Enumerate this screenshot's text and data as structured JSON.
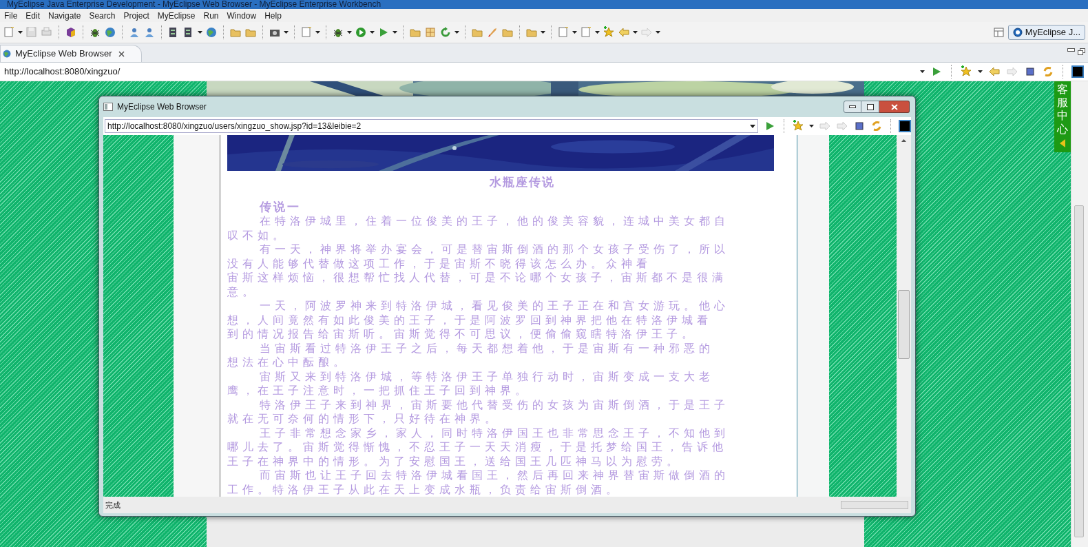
{
  "window": {
    "title": "MyEclipse Java Enterprise Development - MyEclipse Web Browser - MyEclipse Enterprise Workbench"
  },
  "menu": [
    "File",
    "Edit",
    "Navigate",
    "Search",
    "Project",
    "MyEclipse",
    "Run",
    "Window",
    "Help"
  ],
  "perspective": {
    "label": "MyEclipse J..."
  },
  "editor_tab": {
    "label": "MyEclipse Web Browser"
  },
  "address_bar": {
    "value": "http://localhost:8080/xingzuo/"
  },
  "side_tab": {
    "label": "客服中心"
  },
  "popup": {
    "title": "MyEclipse Web Browser",
    "address": "http://localhost:8080/xingzuo/users/xingzuo_show.jsp?id=13&leibie=2",
    "article": {
      "title": "水瓶座传说",
      "heading": "传说一",
      "lines": [
        {
          "kind": "indent",
          "text": "在特洛伊城里，住着一位俊美的王子，他的俊美容貌，连城中美女都自"
        },
        {
          "kind": "wrap",
          "text": "叹不如。"
        },
        {
          "kind": "indent",
          "text": "有一天，神界将举办宴会，可是替宙斯倒酒的那个女孩子受伤了，所以"
        },
        {
          "kind": "wrap",
          "text": "没有人能够代替做这项工作，于是宙斯不晓得该怎么办。众神看"
        },
        {
          "kind": "wrap",
          "text": "宙斯这样烦恼，很想帮忙找人代替，可是不论哪个女孩子，宙斯都不是很满"
        },
        {
          "kind": "wrap",
          "text": "意。"
        },
        {
          "kind": "indent",
          "text": "一天，阿波罗神来到特洛伊城，看见俊美的王子正在和宫女游玩。他心"
        },
        {
          "kind": "wrap",
          "text": "想，人间竟然有如此俊美的王子，于是阿波罗回到神界把他在特洛伊城看"
        },
        {
          "kind": "wrap",
          "text": "到的情况报告给宙斯听。宙斯觉得不可思议，便偷偷窥瞎特洛伊王子。"
        },
        {
          "kind": "indent",
          "text": "当宙斯看过特洛伊王子之后，每天都想着他，于是宙斯有一种邪恶的"
        },
        {
          "kind": "wrap",
          "text": "想法在心中酝酿。"
        },
        {
          "kind": "indent",
          "text": "宙斯又来到特洛伊城，等特洛伊王子单独行动时，宙斯变成一支大老"
        },
        {
          "kind": "wrap",
          "text": "鹰，在王子注意时，一把抓住王子回到神界。"
        },
        {
          "kind": "indent",
          "text": "特洛伊王子来到神界，宙斯要他代替受伤的女孩为宙斯倒酒，于是王子"
        },
        {
          "kind": "wrap",
          "text": "就在无可奈何的情形下，只好待在神界。"
        },
        {
          "kind": "indent",
          "text": "王子非常想念家乡，家人，同时特洛伊国王也非常思念王子，不知他到"
        },
        {
          "kind": "wrap",
          "text": "哪儿去了。宙斯觉得惭愧，不忍王子一天天消瘦，于是托梦给国王，告诉他"
        },
        {
          "kind": "wrap",
          "text": "王子在神界中的情形。为了安慰国王，送给国王几匹神马以为慰劳。"
        },
        {
          "kind": "indent",
          "text": "而宙斯也让王子回去特洛伊城看国王，然后再回来神界替宙斯做倒酒的"
        },
        {
          "kind": "wrap",
          "text": "工作。特洛伊王子从此在天上变成水瓶，负责给宙斯倒酒。"
        }
      ]
    },
    "status": "完成"
  }
}
